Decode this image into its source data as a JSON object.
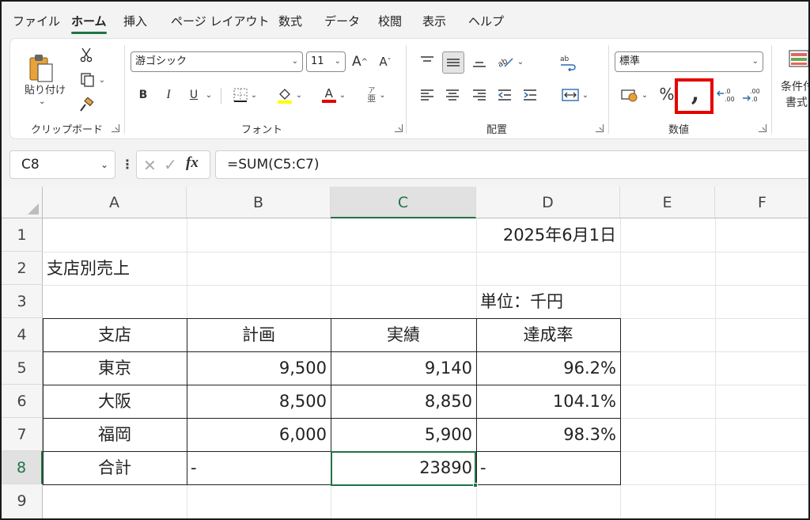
{
  "tabs": [
    "ファイル",
    "ホーム",
    "挿入",
    "ページ レイアウト",
    "数式",
    "データ",
    "校閲",
    "表示",
    "ヘルプ"
  ],
  "ribbon": {
    "clipboard": {
      "paste_label": "貼り付け",
      "group_label": "クリップボード"
    },
    "font": {
      "font_name": "游ゴシック",
      "font_size": "11",
      "grow": "A",
      "shrink": "A",
      "bold": "B",
      "italic": "I",
      "underline": "U",
      "font_color_letter": "A",
      "phonetic_top": "ア",
      "phonetic_bottom": "亜",
      "group_label": "フォント"
    },
    "alignment": {
      "group_label": "配置"
    },
    "number": {
      "format": "標準",
      "percent": "%",
      "comma": ",",
      "group_label": "数値"
    },
    "styles": {
      "cond_format_line1": "条件付",
      "cond_format_line2": "書式"
    }
  },
  "formula_bar": {
    "name_box": "C8",
    "fx": "fx",
    "formula": "=SUM(C5:C7)"
  },
  "columns": [
    "A",
    "B",
    "C",
    "D",
    "E",
    "F"
  ],
  "rows": [
    "1",
    "2",
    "3",
    "4",
    "5",
    "6",
    "7",
    "8",
    "9"
  ],
  "cells": {
    "D1": "2025年6月1日",
    "A2": "支店別売上",
    "D3": "単位：千円",
    "A4": "支店",
    "B4": "計画",
    "C4": "実績",
    "D4": "達成率",
    "A5": "東京",
    "B5": "9,500",
    "C5": "9,140",
    "D5": "96.2%",
    "A6": "大阪",
    "B6": "8,500",
    "C6": "8,850",
    "D6": "104.1%",
    "A7": "福岡",
    "B7": "6,000",
    "C7": "5,900",
    "D7": "98.3%",
    "A8": "合計",
    "B8": "-",
    "C8": "23890",
    "D8": "-"
  },
  "colors": {
    "accent": "#217346",
    "highlight": "#e60000",
    "font_color_bar": "#e60000",
    "fill_color_bar": "#ffff00"
  }
}
